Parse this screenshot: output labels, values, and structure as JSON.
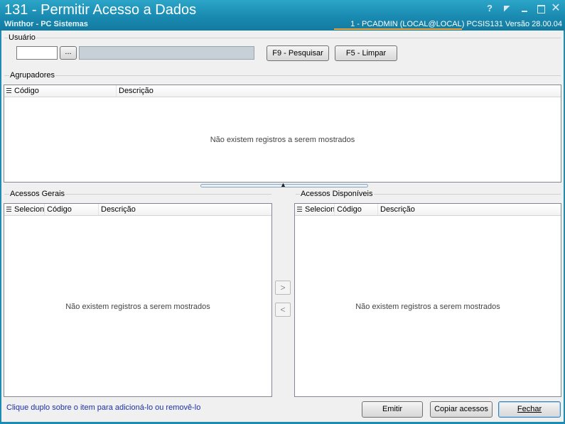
{
  "window": {
    "title": "131 - Permitir Acesso a Dados",
    "subtitle": "Winthor - PC Sistemas",
    "session_info": "1 - PCADMIN (LOCAL@LOCAL)   PCSIS131  Versão 28.00.04",
    "controls": {
      "help": "?",
      "restore_icon": "restore-icon",
      "min_icon": "minimize-icon",
      "max_icon": "maximize-icon",
      "close": "✕"
    }
  },
  "usuario": {
    "group_label": "Usuário",
    "code_value": "",
    "browse_label": "...",
    "name_value": "",
    "search_button": "F9 - Pesquisar",
    "clear_button": "F5 - Limpar"
  },
  "agrupadores": {
    "group_label": "Agrupadores",
    "columns": [
      "Código",
      "Descrição"
    ],
    "rows": [],
    "empty_message": "Não existem registros a serem mostrados"
  },
  "acessos_gerais": {
    "group_label": "Acessos Gerais",
    "columns": [
      "Selecionado",
      "Código",
      "Descrição"
    ],
    "rows": [],
    "empty_message": "Não existem registros a serem mostrados"
  },
  "acessos_disponiveis": {
    "group_label": "Acessos Disponíveis",
    "columns": [
      "Selecionado",
      "Código",
      "Descrição"
    ],
    "rows": [],
    "empty_message": "Não existem registros a serem mostrados"
  },
  "transfer": {
    "add_label": ">",
    "remove_label": "<"
  },
  "footer": {
    "hint": "Clique duplo sobre o item para adicioná-lo ou removê-lo",
    "emitir": "Emitir",
    "copiar": "Copiar acessos",
    "fechar": "Fechar"
  },
  "colors": {
    "titlebar": "#1a8ab1",
    "hint_text": "#1c30a8",
    "accent_line": "#e8a43a"
  }
}
